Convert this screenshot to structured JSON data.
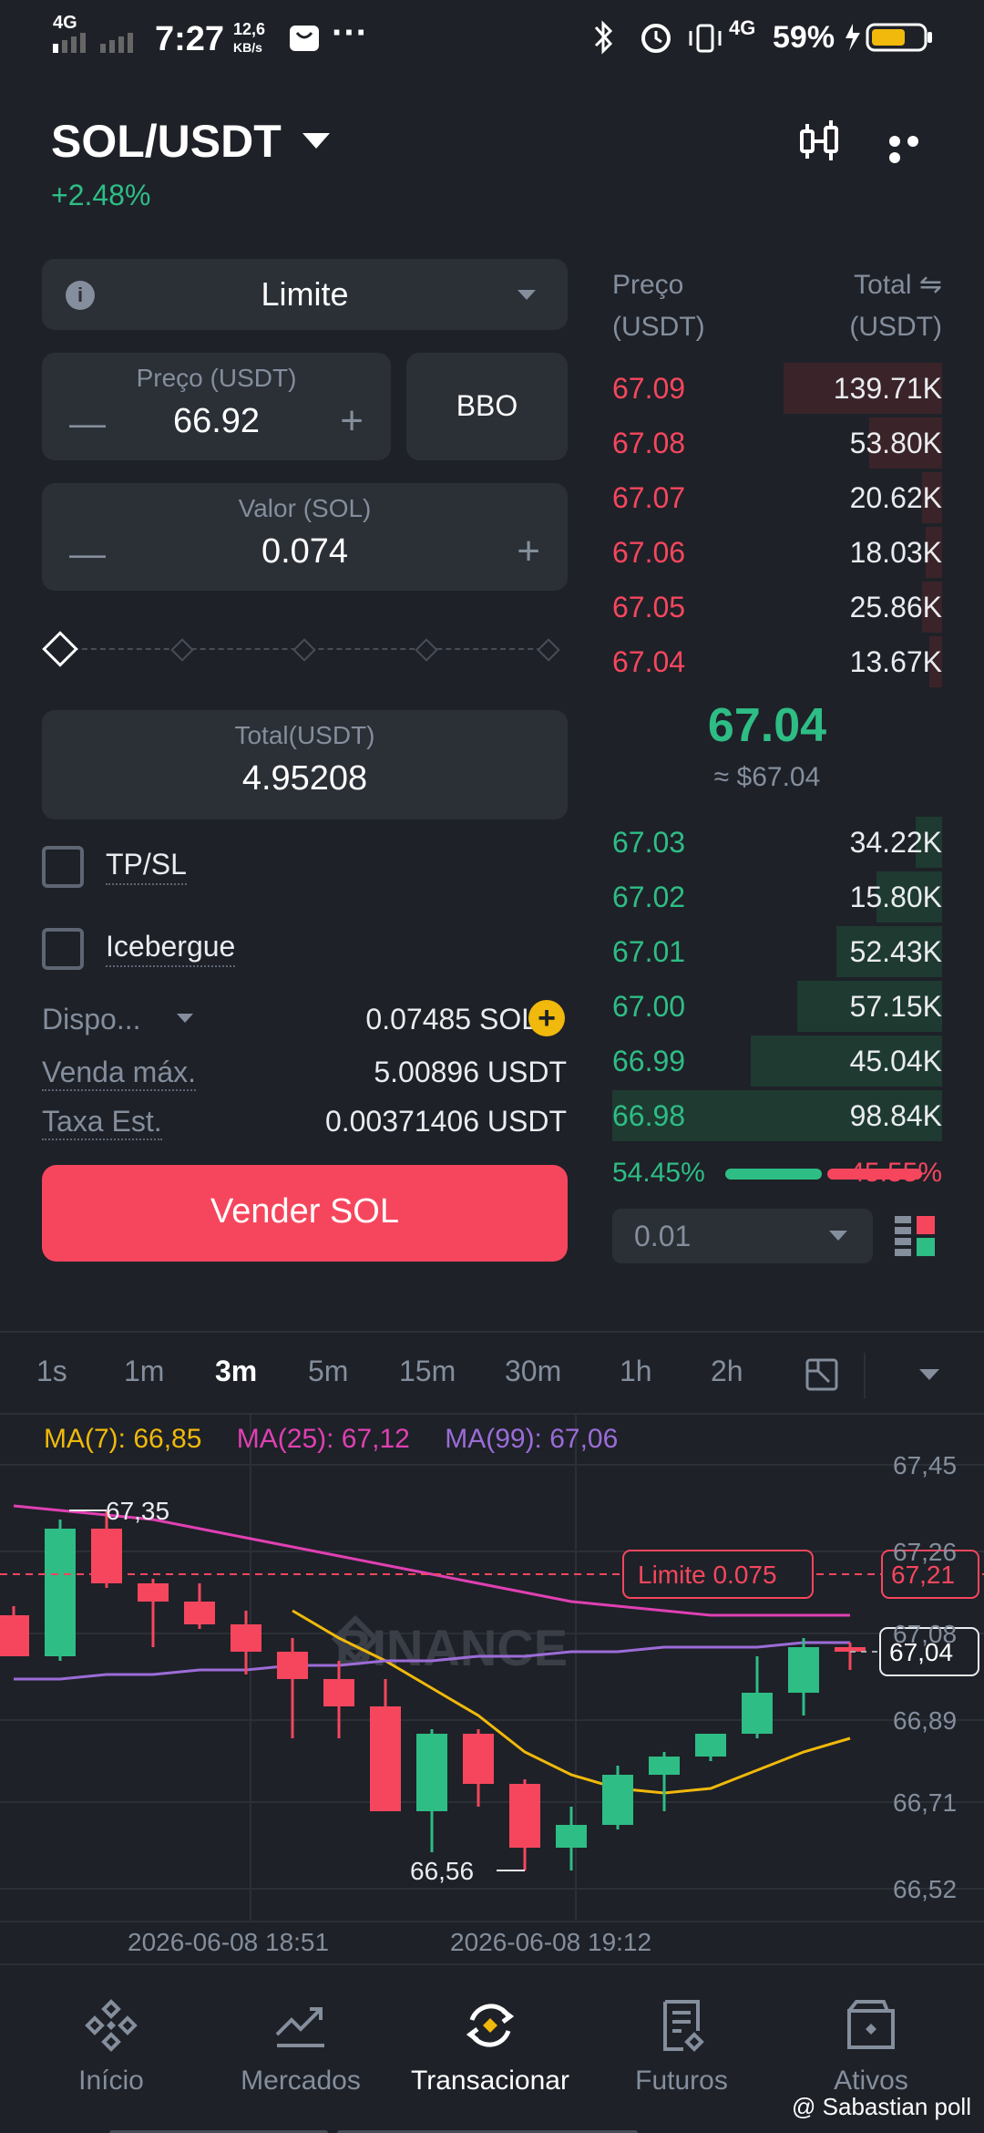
{
  "status": {
    "net": "4G",
    "time": "7:27",
    "speed_top": "12,6",
    "speed_bottom": "KB/s",
    "more": "···",
    "right_net": "4G",
    "battery": "59%"
  },
  "header": {
    "pair": "SOL/USDT",
    "change": "+2.48%"
  },
  "order_form": {
    "type_info": "i",
    "type": "Limite",
    "price_label": "Preço (USDT)",
    "price_value": "66.92",
    "bbo": "BBO",
    "amount_label": "Valor (SOL)",
    "amount_value": "0.074",
    "minus": "—",
    "plus": "+",
    "total_label": "Total(USDT)",
    "total_value": "4.95208",
    "tpsl": "TP/SL",
    "iceberg": "Icebergue",
    "avail_label": "Dispo...",
    "avail_value": "0.07485 SOL",
    "avail_add": "+",
    "max_sell_label": "Venda máx.",
    "max_sell_value": "5.00896 USDT",
    "fee_label": "Taxa Est.",
    "fee_value": "0.00371406 USDT",
    "submit": "Vender SOL"
  },
  "orderbook": {
    "price_header_1": "Preço",
    "price_header_2": "(USDT)",
    "total_header_1": "Total ⇋",
    "total_header_2": "(USDT)",
    "asks": [
      {
        "price": "67.09",
        "total": "139.71K",
        "depth": 0.48
      },
      {
        "price": "67.08",
        "total": "53.80K",
        "depth": 0.22
      },
      {
        "price": "67.07",
        "total": "20.62K",
        "depth": 0.06
      },
      {
        "price": "67.06",
        "total": "18.03K",
        "depth": 0.05
      },
      {
        "price": "67.05",
        "total": "25.86K",
        "depth": 0.06
      },
      {
        "price": "67.04",
        "total": "13.67K",
        "depth": 0.04
      }
    ],
    "mid_price": "67.04",
    "mid_usd": "≈ $67.04",
    "bids": [
      {
        "price": "67.03",
        "total": "34.22K",
        "depth": 0.08
      },
      {
        "price": "67.02",
        "total": "15.80K",
        "depth": 0.2
      },
      {
        "price": "67.01",
        "total": "52.43K",
        "depth": 0.32
      },
      {
        "price": "67.00",
        "total": "57.15K",
        "depth": 0.44
      },
      {
        "price": "66.99",
        "total": "45.04K",
        "depth": 0.58
      },
      {
        "price": "66.98",
        "total": "98.84K",
        "depth": 1.0
      }
    ],
    "buy_ratio": "54.45%",
    "sell_ratio": "45.55%",
    "precision": "0.01"
  },
  "intervals": [
    "1s",
    "1m",
    "3m",
    "5m",
    "15m",
    "30m",
    "1h",
    "2h"
  ],
  "active_interval": "3m",
  "chart_data": {
    "type": "candlestick",
    "ma_labels": [
      "MA(7): 66,85",
      "MA(25): 67,12",
      "MA(99): 67,06"
    ],
    "ma_colors": [
      "#f0b90b",
      "#e040b3",
      "#9c6cd8"
    ],
    "y_ticks": [
      "67,45",
      "67,26",
      "67,08",
      "66,89",
      "66,71",
      "66,52"
    ],
    "y_tick_values": [
      67.45,
      67.26,
      67.08,
      66.89,
      66.71,
      66.52
    ],
    "x_ticks": [
      "2026-06-08 18:51",
      "2026-06-08 19:12"
    ],
    "watermark": "BINANCE",
    "high_label": "67,35",
    "low_label": "66,56",
    "limit_label": "Limite 0.075",
    "limit_price": "67,21",
    "limit_value": 67.21,
    "last_price": "67,04",
    "last_value": 67.04,
    "candles": [
      {
        "o": 67.12,
        "h": 67.14,
        "l": 67.04,
        "c": 67.03
      },
      {
        "o": 67.03,
        "h": 67.33,
        "l": 67.02,
        "c": 67.31
      },
      {
        "o": 67.31,
        "h": 67.35,
        "l": 67.18,
        "c": 67.19
      },
      {
        "o": 67.19,
        "h": 67.2,
        "l": 67.05,
        "c": 67.15
      },
      {
        "o": 67.15,
        "h": 67.19,
        "l": 67.09,
        "c": 67.1
      },
      {
        "o": 67.1,
        "h": 67.13,
        "l": 66.99,
        "c": 67.04
      },
      {
        "o": 67.04,
        "h": 67.07,
        "l": 66.85,
        "c": 66.98
      },
      {
        "o": 66.98,
        "h": 67.02,
        "l": 66.85,
        "c": 66.92
      },
      {
        "o": 66.92,
        "h": 66.98,
        "l": 66.7,
        "c": 66.69
      },
      {
        "o": 66.69,
        "h": 66.87,
        "l": 66.6,
        "c": 66.86
      },
      {
        "o": 66.86,
        "h": 66.87,
        "l": 66.7,
        "c": 66.75
      },
      {
        "o": 66.75,
        "h": 66.76,
        "l": 66.56,
        "c": 66.61
      },
      {
        "o": 66.61,
        "h": 66.7,
        "l": 66.56,
        "c": 66.66
      },
      {
        "o": 66.66,
        "h": 66.79,
        "l": 66.65,
        "c": 66.77
      },
      {
        "o": 66.77,
        "h": 66.82,
        "l": 66.69,
        "c": 66.81
      },
      {
        "o": 66.81,
        "h": 66.86,
        "l": 66.8,
        "c": 66.86
      },
      {
        "o": 66.86,
        "h": 67.03,
        "l": 66.85,
        "c": 66.95
      },
      {
        "o": 66.95,
        "h": 67.07,
        "l": 66.9,
        "c": 67.05
      },
      {
        "o": 67.05,
        "h": 67.06,
        "l": 67.0,
        "c": 67.04
      }
    ],
    "ma7": [
      null,
      null,
      null,
      null,
      null,
      null,
      67.13,
      67.07,
      67.02,
      66.96,
      66.9,
      66.82,
      66.77,
      66.74,
      66.73,
      66.74,
      66.78,
      66.82,
      66.85
    ],
    "ma25": [
      67.36,
      67.35,
      67.34,
      67.33,
      67.31,
      67.29,
      67.27,
      67.25,
      67.23,
      67.21,
      67.19,
      67.17,
      67.15,
      67.14,
      67.13,
      67.12,
      67.12,
      67.12,
      67.12
    ],
    "ma99": [
      66.98,
      66.98,
      66.99,
      66.99,
      67.0,
      67.0,
      67.01,
      67.01,
      67.02,
      67.02,
      67.03,
      67.03,
      67.04,
      67.04,
      67.05,
      67.05,
      67.05,
      67.06,
      67.06
    ]
  },
  "nav": {
    "home": "Início",
    "markets": "Mercados",
    "trade": "Transacionar",
    "futures": "Futuros",
    "assets": "Ativos"
  },
  "watermark_user": "@ Sabastian poll",
  "colors": {
    "green": "#2ebd85",
    "red": "#f6465d",
    "accent": "#f0b90b",
    "bg": "#1e2128"
  }
}
